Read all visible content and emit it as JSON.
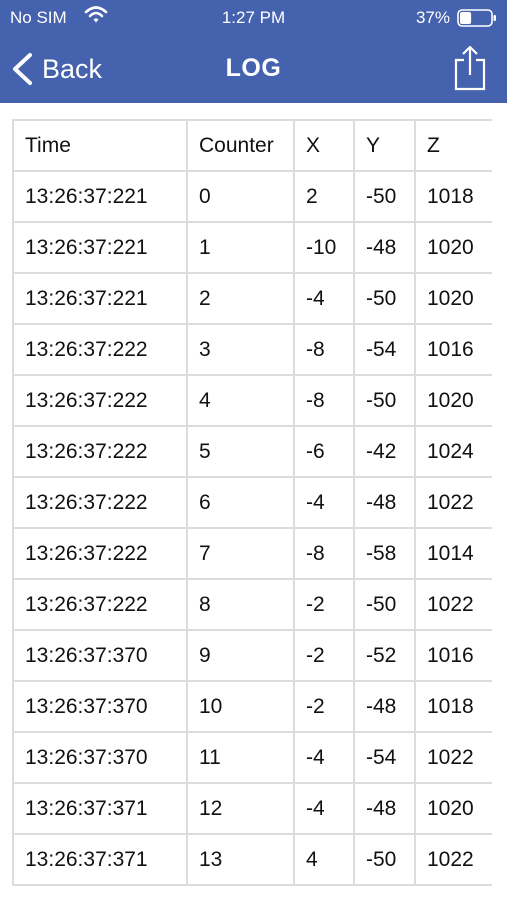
{
  "status_bar": {
    "carrier": "No SIM",
    "time": "1:27 PM",
    "battery": "37%",
    "battery_level": 0.37
  },
  "nav": {
    "back_label": "Back",
    "title": "LOG",
    "share_icon": "share-icon"
  },
  "colors": {
    "bar": "#4462ae",
    "grid": "#dcdcdc"
  },
  "table": {
    "columns": [
      "Time",
      "Counter",
      "X",
      "Y",
      "Z"
    ],
    "rows": [
      [
        "13:26:37:221",
        "0",
        "2",
        "-50",
        "1018"
      ],
      [
        "13:26:37:221",
        "1",
        "-10",
        "-48",
        "1020"
      ],
      [
        "13:26:37:221",
        "2",
        "-4",
        "-50",
        "1020"
      ],
      [
        "13:26:37:222",
        "3",
        "-8",
        "-54",
        "1016"
      ],
      [
        "13:26:37:222",
        "4",
        "-8",
        "-50",
        "1020"
      ],
      [
        "13:26:37:222",
        "5",
        "-6",
        "-42",
        "1024"
      ],
      [
        "13:26:37:222",
        "6",
        "-4",
        "-48",
        "1022"
      ],
      [
        "13:26:37:222",
        "7",
        "-8",
        "-58",
        "1014"
      ],
      [
        "13:26:37:222",
        "8",
        "-2",
        "-50",
        "1022"
      ],
      [
        "13:26:37:370",
        "9",
        "-2",
        "-52",
        "1016"
      ],
      [
        "13:26:37:370",
        "10",
        "-2",
        "-48",
        "1018"
      ],
      [
        "13:26:37:370",
        "11",
        "-4",
        "-54",
        "1022"
      ],
      [
        "13:26:37:371",
        "12",
        "-4",
        "-48",
        "1020"
      ],
      [
        "13:26:37:371",
        "13",
        "4",
        "-50",
        "1022"
      ]
    ]
  }
}
